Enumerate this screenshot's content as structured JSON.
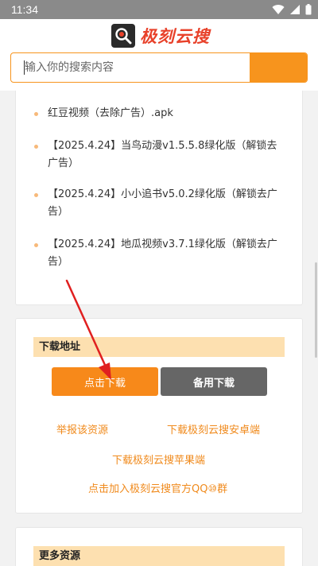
{
  "status_bar": {
    "time": "11:34"
  },
  "header": {
    "logo_text": "极刻云搜"
  },
  "search": {
    "placeholder": "输入你的搜索内容"
  },
  "results": {
    "items": [
      {
        "label": "红豆视频（去除广告）.apk"
      },
      {
        "label": "【2025.4.24】当鸟动漫v1.5.5.8绿化版（解锁去广告）"
      },
      {
        "label": "【2025.4.24】小小追书v5.0.2绿化版（解锁去广告）"
      },
      {
        "label": "【2025.4.24】地瓜视频v3.7.1绿化版（解锁去广告）"
      }
    ]
  },
  "download": {
    "title": "下载地址",
    "primary_button": "点击下载",
    "secondary_button": "备用下载",
    "links": {
      "report": "举报该资源",
      "android": "下载极刻云搜安卓端",
      "ios": "下载极刻云搜苹果端",
      "qq_group": "点击加入极刻云搜官方QQ⑩群"
    }
  },
  "more": {
    "title": "更多资源"
  },
  "colors": {
    "accent": "#f7941d",
    "button_primary": "#f7891a",
    "button_secondary": "#666666",
    "section_header_bg": "#fde0b0",
    "link": "#f08a1c",
    "annotation_arrow": "#e02020"
  }
}
